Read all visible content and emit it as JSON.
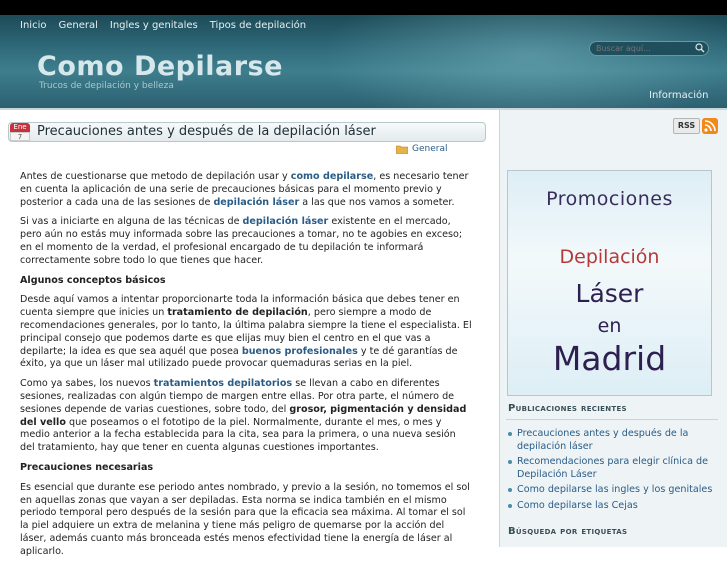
{
  "nav": [
    "Inicio",
    "General",
    "Ingles y genitales",
    "Tipos de depilación"
  ],
  "site": {
    "title": "Como Depilarse",
    "subtitle": "Trucos de depilación y belleza",
    "search_placeholder": "Buscar aquí...",
    "info_link": "Información"
  },
  "post": {
    "date_month": "Ene",
    "date_day": "7",
    "title": "Precauciones antes y después de la depilación láser",
    "category": "General",
    "p1_a": "Antes de cuestionarse que metodo de depilación usar y ",
    "p1_link": "como depilarse",
    "p1_b": ", es necesario tener en cuenta la aplicación de una serie de precauciones básicas para el momento previo y posterior a cada una de las sesiones de ",
    "p1_link2": "depilación láser",
    "p1_c": " a las que nos vamos a someter.",
    "p2_a": "Si vas a iniciarte en alguna de las técnicas de ",
    "p2_link": "depilación láser",
    "p2_b": " existente en el mercado, pero aún no estás muy informada sobre las precauciones a tomar, no te agobies en exceso; en el momento de la verdad, el profesional encargado de tu depilación te informará correctamente sobre todo lo que tienes que hacer.",
    "h1": "Algunos conceptos básicos",
    "p3_a": "Desde aquí vamos a intentar proporcionarte toda la información básica que debes tener en cuenta siempre que inicies un ",
    "p3_bold": "tratamiento de depilación",
    "p3_b": ", pero siempre a modo de recomendaciones generales, por lo tanto, la última palabra siempre la tiene el especialista. El principal consejo que podemos darte es que elijas muy bien el centro en el que vas a depilarte; la idea es que sea aquél que posea ",
    "p3_link": "buenos profesionales",
    "p3_c": " y te dé garantías de éxito, ya que un láser mal utilizado puede provocar quemaduras serias en la piel.",
    "p4_a": "Como ya sabes, los nuevos ",
    "p4_link": "tratamientos depilatorios",
    "p4_b": " se llevan a cabo en diferentes sesiones, realizadas con algún tiempo de margen entre ellas. Por otra parte, el número de sesiones depende de varias cuestiones, sobre todo, del ",
    "p4_bold": "grosor, pigmentación y densidad del vello",
    "p4_c": " que poseamos o el fototipo de la piel. Normalmente, durante el mes, o mes y medio anterior a la fecha establecida para la cita, sea para la primera, o una nueva sesión del tratamiento, hay que tener en cuenta algunas cuestiones importantes.",
    "h2": "Precauciones necesarias",
    "p5": "Es esencial que durante ese periodo antes nombrado, y previo a la sesión, no tomemos el sol en aquellas zonas que vayan a ser depiladas. Esta norma se indica también en el mismo periodo temporal pero después de la sesión para que la eficacia sea máxima. Al tomar el sol la piel adquiere un extra de melanina y tiene más peligro de quemarse por la acción del láser, además cuanto más bronceada estés menos efectividad tiene la energía de láser al aplicarlo."
  },
  "sidebar": {
    "rss_label": "RSS",
    "promo": {
      "line1": "Promociones",
      "line2": "Depilación",
      "line3": "Láser",
      "line4": "en",
      "line5": "Madrid"
    },
    "recent_title": "Publicaciones recientes",
    "recent_items": [
      "Precauciones antes y después de la depilación láser",
      "Recomendaciones para elegir clínica de Depilación Láser",
      "Como depilarse las ingles y los genitales",
      "Como depilarse las Cejas"
    ],
    "tags_title": "Búsqueda por etiquetas"
  },
  "colors": {
    "header_dark": "#1d4a57",
    "link": "#2a5c87",
    "sidebar_bg": "#eef3f6",
    "rss_orange": "#f08a1c"
  }
}
